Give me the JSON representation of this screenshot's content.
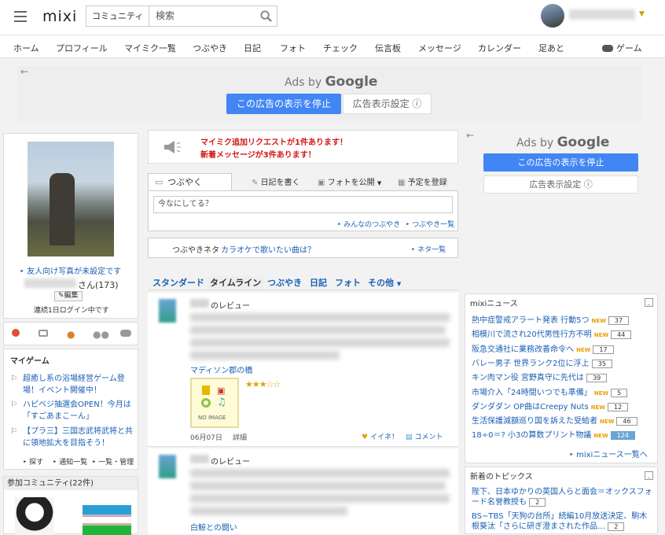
{
  "header": {
    "logo": "mixi",
    "search_category": "コミュニティ",
    "search_placeholder": "検索"
  },
  "nav": {
    "items": [
      "ホーム",
      "プロフィール",
      "マイミク一覧",
      "つぶやき",
      "日記",
      "フォト",
      "チェック",
      "伝言板",
      "メッセージ",
      "カレンダー",
      "足あと"
    ],
    "game": "ゲーム"
  },
  "ad_top": {
    "ads_by": "Ads by",
    "google": "Google",
    "stop": "この広告の表示を停止",
    "settings": "広告表示設定 ⓘ"
  },
  "profile": {
    "photo_notice": "友人向け写真が未設定です",
    "name_suffix": "さん(173)",
    "edit": "編集",
    "login_streak": "連続1日ログイン中です"
  },
  "mygame": {
    "title": "マイゲーム",
    "items": [
      "超癒し系の浴場経営ゲーム登場！イベント開催中！",
      "ハピベジ抽選会OPEN！今月は「すごあまこーん」",
      "【プラ三】三国志武将武将と共に領地拡大を目指そう！"
    ],
    "links": [
      "探す",
      "通知一覧",
      "一覧・管理"
    ]
  },
  "community": {
    "title": "参加コミュニティ(22件)"
  },
  "alerts": {
    "line1": "マイミク追加リクエストが1件あります！",
    "line2": "新着メッセージが3件あります！"
  },
  "tsubuyaki": {
    "tab": "つぶやく",
    "diary": "日記を書く",
    "photo": "フォトを公開",
    "schedule": "予定を登録",
    "placeholder": "今なにしてる？",
    "all": "みんなのつぶやき",
    "list": "つぶやき一覧",
    "neta_label": "つぶやきネタ",
    "neta_text": "カラオケで歌いたい曲は？",
    "neta_list": "ネタ一覧"
  },
  "feed_tabs": [
    "スタンダード",
    "タイムライン",
    "つぶやき",
    "日記",
    "フォト",
    "その他"
  ],
  "feed": {
    "review_label": "のレビュー",
    "item1_title": "マディソン郡の橋",
    "no_image": "NO IMAGE",
    "date": "06月07日",
    "detail": "詳細",
    "iine": "イイネ！",
    "comment": "コメント",
    "item2_title": "白鯨との闘い"
  },
  "ad_right": {
    "ads_by": "Ads by",
    "google": "Google",
    "stop": "この広告の表示を停止",
    "settings": "広告表示設定 ⓘ"
  },
  "news": {
    "title": "mixiニュース",
    "items": [
      {
        "text": "熱中症警戒アラート発表 行動5つ",
        "new": true,
        "count": "37",
        "hl": false
      },
      {
        "text": "相模川で流され20代男性行方不明",
        "new": true,
        "count": "44",
        "hl": false
      },
      {
        "text": "阪急交通社に業務改善命令へ",
        "new": true,
        "count": "17",
        "hl": false
      },
      {
        "text": "バレー男子 世界ランク2位に浮上",
        "new": false,
        "count": "35",
        "hl": false
      },
      {
        "text": "キン肉マン役 宮野真守に先代は",
        "new": false,
        "count": "39",
        "hl": false
      },
      {
        "text": "市場介入「24時間いつでも準備」",
        "new": true,
        "count": "5",
        "hl": false
      },
      {
        "text": "ダンダダン OP曲はCreepy Nuts",
        "new": true,
        "count": "12",
        "hl": false
      },
      {
        "text": "生活保護減額巡り国を訴えた受給者",
        "new": true,
        "count": "46",
        "hl": false
      },
      {
        "text": "18÷0＝? 小3の算数プリント物議",
        "new": true,
        "count": "124",
        "hl": true
      }
    ],
    "more": "mixiニュース一覧へ"
  },
  "topics": {
    "title": "新着のトピックス",
    "item1a": "陛下、日本ゆかりの英国人らと面会＝オックスフォード名誉教授も",
    "item1_count": "2",
    "item2a": "BS−TBS「天狗の台所」続編10月放送決定、駒木根葵汰「さらに研ぎ澄まされた作品…",
    "item2_count": "2"
  },
  "icons": [
    "hamburger-icon",
    "search-icon",
    "megaphone-icon",
    "pencil-icon",
    "camera-icon",
    "calendar-icon",
    "like-icon",
    "comment-icon",
    "game-icon"
  ]
}
